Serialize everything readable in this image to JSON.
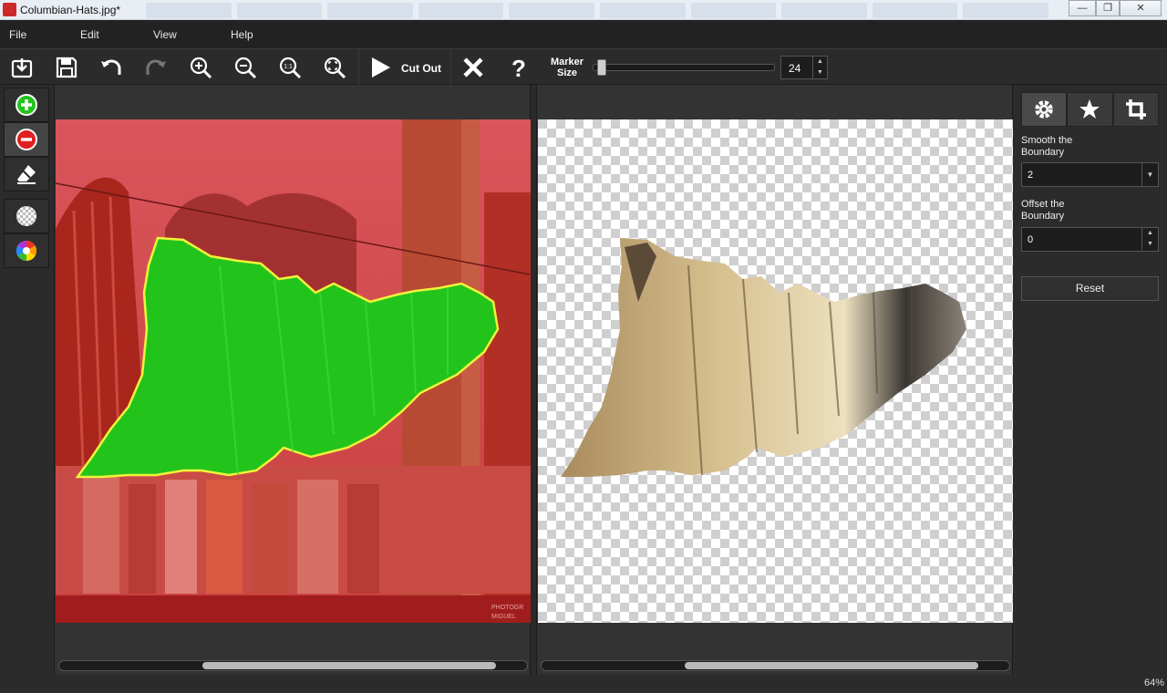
{
  "window": {
    "title": "Columbian-Hats.jpg*"
  },
  "menu": {
    "file": "File",
    "edit": "Edit",
    "view": "View",
    "help": "Help"
  },
  "toolbar": {
    "cutout_label": "Cut Out",
    "marker_size_label": "Marker Size",
    "marker_size_value": "24"
  },
  "right_panel": {
    "smooth_label": "Smooth the Boundary",
    "smooth_value": "2",
    "offset_label": "Offset the Boundary",
    "offset_value": "0",
    "reset_label": "Reset"
  },
  "status": {
    "zoom": "64%"
  },
  "colors": {
    "foreground_marker": "#22c41c",
    "background_marker": "#e02020",
    "boundary": "#f2f23a"
  },
  "icons": [
    "open-icon",
    "save-icon",
    "undo-icon",
    "redo-icon",
    "zoom-in-icon",
    "zoom-out-icon",
    "actual-size-icon",
    "fit-icon",
    "play-icon",
    "close-icon",
    "help-icon",
    "add-marker-icon",
    "remove-marker-icon",
    "eraser-icon",
    "transparency-icon",
    "color-wheel-icon",
    "gear-icon",
    "star-icon",
    "crop-icon"
  ]
}
